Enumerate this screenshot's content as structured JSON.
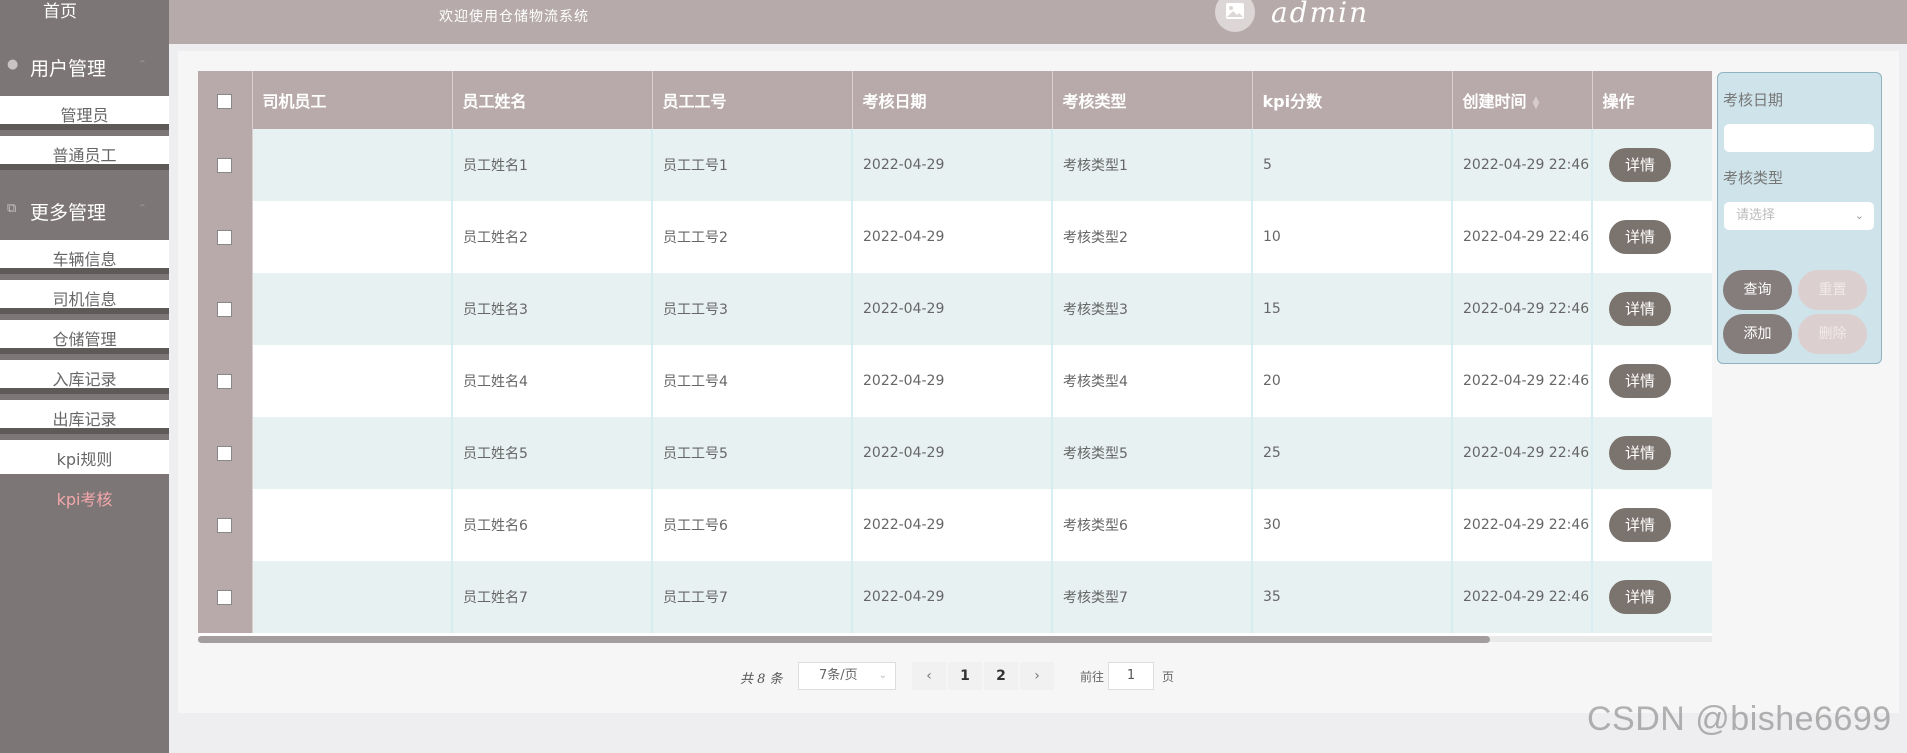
{
  "sidebar": {
    "home": "首页",
    "groups": [
      {
        "label": "用户管理",
        "icon": "user-icon"
      },
      {
        "label": "更多管理",
        "icon": "copy-icon"
      }
    ],
    "user_items": [
      "管理员",
      "普通员工"
    ],
    "more_items": [
      "车辆信息",
      "司机信息",
      "仓储管理",
      "入库记录",
      "出库记录",
      "kpi规则",
      "kpi考核"
    ],
    "active_item": "kpi考核"
  },
  "header": {
    "welcome": "欢迎使用仓储物流系统",
    "username": "admin",
    "avatar_icon": "image-icon"
  },
  "table": {
    "columns": [
      "司机员工",
      "员工姓名",
      "员工工号",
      "考核日期",
      "考核类型",
      "kpi分数",
      "创建时间",
      "操作"
    ],
    "rows": [
      {
        "driver": "",
        "name": "员工姓名1",
        "id": "员工工号1",
        "date": "2022-04-29",
        "type": "考核类型1",
        "score": "5",
        "created": "2022-04-29 22:46",
        "action": "详情"
      },
      {
        "driver": "",
        "name": "员工姓名2",
        "id": "员工工号2",
        "date": "2022-04-29",
        "type": "考核类型2",
        "score": "10",
        "created": "2022-04-29 22:46",
        "action": "详情"
      },
      {
        "driver": "",
        "name": "员工姓名3",
        "id": "员工工号3",
        "date": "2022-04-29",
        "type": "考核类型3",
        "score": "15",
        "created": "2022-04-29 22:46",
        "action": "详情"
      },
      {
        "driver": "",
        "name": "员工姓名4",
        "id": "员工工号4",
        "date": "2022-04-29",
        "type": "考核类型4",
        "score": "20",
        "created": "2022-04-29 22:46",
        "action": "详情"
      },
      {
        "driver": "",
        "name": "员工姓名5",
        "id": "员工工号5",
        "date": "2022-04-29",
        "type": "考核类型5",
        "score": "25",
        "created": "2022-04-29 22:46",
        "action": "详情"
      },
      {
        "driver": "",
        "name": "员工姓名6",
        "id": "员工工号6",
        "date": "2022-04-29",
        "type": "考核类型6",
        "score": "30",
        "created": "2022-04-29 22:46",
        "action": "详情"
      },
      {
        "driver": "",
        "name": "员工姓名7",
        "id": "员工工号7",
        "date": "2022-04-29",
        "type": "考核类型7",
        "score": "35",
        "created": "2022-04-29 22:46",
        "action": "详情"
      }
    ]
  },
  "pagination": {
    "total": "共 8 条",
    "page_size": "7条/页",
    "prev": "‹",
    "pages": [
      "1",
      "2"
    ],
    "current": "1",
    "next": "›",
    "goto_prefix": "前往",
    "goto_value": "1",
    "goto_suffix": "页"
  },
  "search": {
    "date_label": "考核日期",
    "date_value": "",
    "type_label": "考核类型",
    "type_placeholder": "请选择",
    "buttons": {
      "query": "查询",
      "reset": "重置",
      "add": "添加",
      "delete": "删除"
    }
  },
  "watermark": "CSDN @bishe6699",
  "colors": {
    "sidebar_bg": "#7d7676",
    "header_bg": "#b6aaaa",
    "table_header_bg": "#b8aaaa",
    "row_alt_bg": "#e8f1f2",
    "detail_button": "#7b736e",
    "active_menu_text": "#f4a7ab",
    "search_panel_bg": "#cfe3ea"
  }
}
